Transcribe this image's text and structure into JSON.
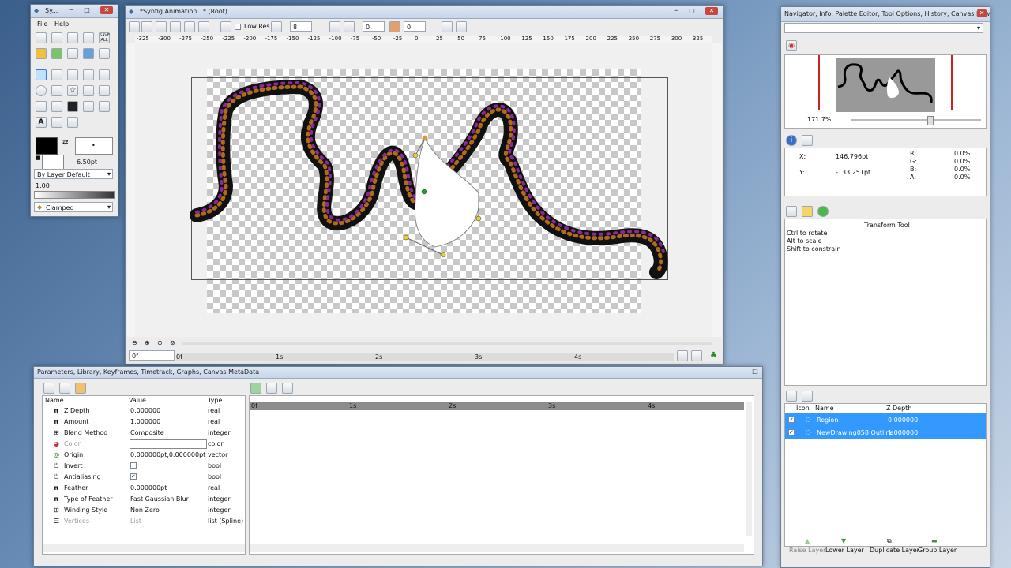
{
  "toolbox": {
    "title": "Sy...",
    "menu": [
      "File",
      "Help"
    ],
    "width_value": "6.50pt",
    "blend": "By Layer Default",
    "amount": "1.00",
    "interpolation": "Clamped",
    "save_all": "SAVE ALL"
  },
  "canvas": {
    "title": "*Synfig Animation 1* (Root)",
    "low_res": "Low Res",
    "quality": "8",
    "time_a": "0",
    "time_b": "0",
    "current_time": "0f",
    "ruler_marks": [
      "-325",
      "-300",
      "-275",
      "-250",
      "-225",
      "-200",
      "-175",
      "-150",
      "-125",
      "-100",
      "-75",
      "-50",
      "-25",
      "0",
      "25",
      "50",
      "75",
      "100",
      "125",
      "150",
      "175",
      "200",
      "225",
      "250",
      "275",
      "300",
      "325"
    ],
    "time_marks": [
      "0f",
      "1s",
      "2s",
      "3s",
      "4s"
    ]
  },
  "params": {
    "title": "Parameters, Library, Keyframes, Timetrack, Graphs, Canvas MetaData",
    "headers": [
      "Name",
      "Value",
      "Type"
    ],
    "rows": [
      {
        "name": "Z Depth",
        "value": "0.000000",
        "type": "real"
      },
      {
        "name": "Amount",
        "value": "1.000000",
        "type": "real"
      },
      {
        "name": "Blend Method",
        "value": "Composite",
        "type": "integer"
      },
      {
        "name": "Color",
        "value": "",
        "type": "color"
      },
      {
        "name": "Origin",
        "value": "0.000000pt,0.000000pt",
        "type": "vector"
      },
      {
        "name": "Invert",
        "value": "",
        "type": "bool"
      },
      {
        "name": "Antialiasing",
        "value": "",
        "type": "bool"
      },
      {
        "name": "Feather",
        "value": "0.000000pt",
        "type": "real"
      },
      {
        "name": "Type of Feather",
        "value": "Fast Gaussian Blur",
        "type": "integer"
      },
      {
        "name": "Winding Style",
        "value": "Non Zero",
        "type": "integer"
      },
      {
        "name": "Vertices",
        "value": "List",
        "type": "list (Spline)"
      }
    ],
    "time_marks": [
      "0f",
      "1s",
      "2s",
      "3s",
      "4s"
    ]
  },
  "right": {
    "title": "Navigator, Info, Palette Editor, Tool Options, History, Canvas Brows...",
    "zoom": "171.7%",
    "info": {
      "x_label": "X:",
      "x": "146.796pt",
      "y_label": "Y:",
      "y": "-133.251pt",
      "r_label": "R:",
      "r": "0.0%",
      "g_label": "G:",
      "g": "0.0%",
      "b_label": "B:",
      "b": "0.0%",
      "a_label": "A:",
      "a": "0.0%"
    },
    "tool_title": "Transform Tool",
    "tool_hints": [
      "Ctrl to rotate",
      "Alt to scale",
      "Shift to constrain"
    ],
    "layers_headers": [
      "Icon",
      "Name",
      "Z Depth"
    ],
    "layers": [
      {
        "name": "Region",
        "z": "0.000000"
      },
      {
        "name": "NewDrawing058 Outline",
        "z": "1.000000"
      }
    ],
    "buttons": [
      "Raise Layer",
      "Lower Layer",
      "Duplicate Layer",
      "Group Layer"
    ]
  }
}
